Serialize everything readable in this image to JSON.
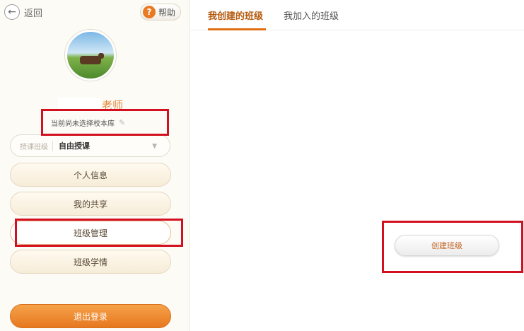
{
  "sidebar": {
    "back_label": "返回",
    "help_label": "帮助",
    "teacher_suffix": "老师",
    "school_note": "当前尚未选择校本库",
    "select": {
      "label": "授课班级",
      "value": "自由授课"
    },
    "menu": [
      {
        "label": "个人信息"
      },
      {
        "label": "我的共享"
      },
      {
        "label": "班级管理"
      },
      {
        "label": "班级学情"
      }
    ],
    "logout_label": "退出登录"
  },
  "main": {
    "tabs": [
      {
        "label": "我创建的班级",
        "active": true
      },
      {
        "label": "我加入的班级",
        "active": false
      }
    ],
    "create_button_label": "创建班级"
  },
  "colors": {
    "accent": "#e06f14",
    "highlight_box": "#d3101f",
    "logout_bg": "#f08c33"
  }
}
